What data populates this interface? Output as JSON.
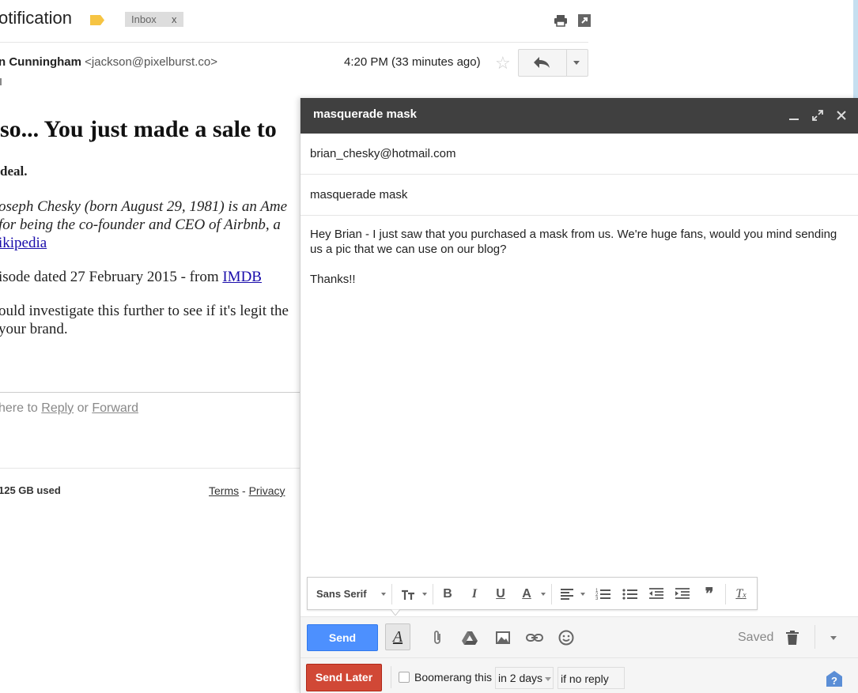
{
  "email": {
    "subject": "otification",
    "label_chip": "Inbox",
    "label_chip_close": "x",
    "sender_name": "n Cunningham",
    "sender_email": "<jackson@pixelburst.co>",
    "time": "4:20 PM (33 minutes ago)",
    "headline": "so... You just made a sale to",
    "deal": "deal.",
    "bio_line1": "oseph Chesky (born August 29, 1981) is an Ame",
    "bio_line2": "for being the co-founder and CEO of Airbnb, a",
    "wiki_link": "ikipedia",
    "episode_text": "isode dated 27 February 2015 - from",
    "imdb_link": "IMDB",
    "investigate_line1": "ould investigate this further to see if it's legit the",
    "investigate_line2": "your brand.",
    "reply_prompt_prefix": "here to",
    "reply_link": "Reply",
    "reply_or": "or",
    "forward_link": "Forward",
    "storage_text": "125 GB used",
    "terms_link": "Terms",
    "footer_sep": "-",
    "privacy_link": "Privacy"
  },
  "compose": {
    "title": "masquerade mask",
    "to": "brian_chesky@hotmail.com",
    "subject": "masquerade mask",
    "body_para1": "Hey Brian - I just saw that you purchased a mask from us. We're huge fans, would you mind sending us a pic that we can use on our blog?",
    "body_para2": "Thanks!!",
    "font_name": "Sans Serif",
    "send_label": "Send",
    "format_toggle": "A",
    "saved_label": "Saved",
    "send_later_label": "Send Later",
    "boomerang_label": "Boomerang this",
    "boomerang_when": "in 2 days",
    "boomerang_condition": "if no reply"
  },
  "colors": {
    "compose_titlebar": "#404040",
    "send_button": "#4d90fe",
    "send_later_button": "#d14836",
    "link": "#1a0dab",
    "label_tag": "#f6c443",
    "help_icon": "#5b8ed6"
  },
  "icons": {
    "title_bar": [
      "minimize-icon",
      "expand-icon",
      "close-icon"
    ],
    "format_bar": [
      "font-size-icon",
      "bold-icon",
      "italic-icon",
      "underline-icon",
      "text-color-icon",
      "align-icon",
      "numbered-list-icon",
      "bulleted-list-icon",
      "indent-less-icon",
      "indent-more-icon",
      "quote-icon",
      "remove-formatting-icon"
    ],
    "bottom_bar": [
      "attach-icon",
      "drive-icon",
      "photo-icon",
      "link-icon",
      "emoji-icon",
      "trash-icon"
    ]
  }
}
